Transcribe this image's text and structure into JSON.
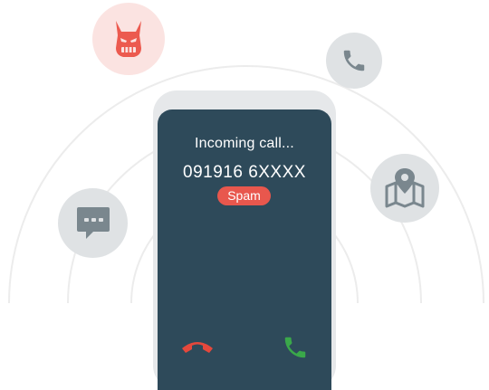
{
  "call": {
    "title": "Incoming call...",
    "number": "091916 6XXXX",
    "tag": "Spam"
  },
  "icons": {
    "threat": "devil-face-icon",
    "phone": "phone-icon",
    "map": "map-pin-icon",
    "chat": "chat-bubble-icon",
    "decline": "hang-up-icon",
    "answer": "answer-call-icon"
  },
  "colors": {
    "screen": "#2e4a5a",
    "spam": "#e8574d",
    "threat": "#ec5a4f",
    "icon_gray": "#7a878e",
    "decline": "#e5483c",
    "answer": "#3aa84a"
  }
}
